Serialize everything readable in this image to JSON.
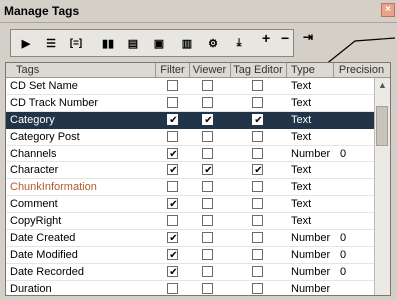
{
  "window": {
    "title": "Manage Tags",
    "close": "×"
  },
  "toolbar": {
    "buttons": [
      {
        "name": "play",
        "glyph": "▶"
      },
      {
        "name": "sort",
        "glyph": "☰"
      },
      {
        "name": "brackets",
        "glyph": "[=]"
      },
      {
        "name": "columns",
        "glyph": "▮▮"
      },
      {
        "name": "grid",
        "glyph": "▤"
      },
      {
        "name": "window",
        "glyph": "▣"
      },
      {
        "name": "table",
        "glyph": "▥"
      },
      {
        "name": "gear",
        "glyph": "⚙"
      },
      {
        "name": "download",
        "glyph": "⤓"
      }
    ],
    "extras": {
      "plus": "+",
      "minus": "−",
      "pipe": "⇥"
    }
  },
  "columns": {
    "tags": "Tags",
    "filter": "Filter",
    "viewer": "Viewer",
    "editor": "Tag Editor",
    "type": "Type",
    "precision": "Precision"
  },
  "rows": [
    {
      "name": "CD Set Name",
      "filter": false,
      "viewer": false,
      "editor": false,
      "type": "Text",
      "precision": ""
    },
    {
      "name": "CD Track Number",
      "filter": false,
      "viewer": false,
      "editor": false,
      "type": "Text",
      "precision": ""
    },
    {
      "name": "Category",
      "filter": true,
      "viewer": true,
      "editor": true,
      "type": "Text",
      "precision": "",
      "selected": true
    },
    {
      "name": "Category Post",
      "filter": false,
      "viewer": false,
      "editor": false,
      "type": "Text",
      "precision": ""
    },
    {
      "name": "Channels",
      "filter": true,
      "viewer": false,
      "editor": false,
      "type": "Number",
      "precision": "0"
    },
    {
      "name": "Character",
      "filter": true,
      "viewer": true,
      "editor": true,
      "type": "Text",
      "precision": ""
    },
    {
      "name": "ChunkInformation",
      "filter": false,
      "viewer": false,
      "editor": false,
      "type": "Text",
      "precision": "",
      "color": "#b05a2a"
    },
    {
      "name": "Comment",
      "filter": true,
      "viewer": false,
      "editor": false,
      "type": "Text",
      "precision": ""
    },
    {
      "name": "CopyRight",
      "filter": false,
      "viewer": false,
      "editor": false,
      "type": "Text",
      "precision": ""
    },
    {
      "name": "Date Created",
      "filter": true,
      "viewer": false,
      "editor": false,
      "type": "Number",
      "precision": "0"
    },
    {
      "name": "Date Modified",
      "filter": true,
      "viewer": false,
      "editor": false,
      "type": "Number",
      "precision": "0"
    },
    {
      "name": "Date Recorded",
      "filter": true,
      "viewer": false,
      "editor": false,
      "type": "Number",
      "precision": "0"
    },
    {
      "name": "Duration",
      "filter": false,
      "viewer": false,
      "editor": false,
      "type": "Number",
      "precision": ""
    }
  ]
}
